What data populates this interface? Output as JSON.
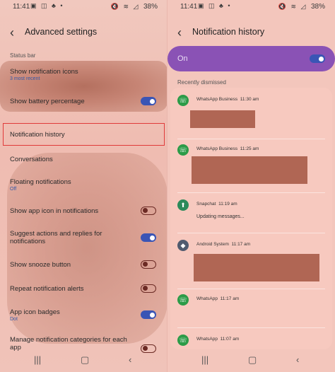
{
  "left": {
    "status": {
      "time": "11:41",
      "noti_icons": "▣ ◫ ♣ •",
      "sys_icons": "🔇 ≋ ◿",
      "battery": "38%"
    },
    "header": {
      "title": "Advanced settings"
    },
    "section_status_bar": "Status bar",
    "items": [
      {
        "label": "Show notification icons",
        "sub": "3 most recent"
      },
      {
        "label": "Show battery percentage",
        "toggle": "on"
      },
      {
        "label": "Notification history"
      },
      {
        "label": "Conversations"
      },
      {
        "label": "Floating notifications",
        "sub": "Off"
      },
      {
        "label": "Show app icon in notifications",
        "toggle": "off"
      },
      {
        "label": "Suggest actions and replies for notifications",
        "toggle": "on"
      },
      {
        "label": "Show snooze button",
        "toggle": "off"
      },
      {
        "label": "Repeat notification alerts",
        "toggle": "off"
      },
      {
        "label": "App icon badges",
        "sub": "Dot",
        "toggle": "on"
      },
      {
        "label": "Manage notification categories for each app",
        "toggle": "off"
      }
    ]
  },
  "right": {
    "status": {
      "time": "11:41",
      "noti_icons": "▣ ◫ ♣ •",
      "sys_icons": "🔇 ≋ ◿",
      "battery": "38%"
    },
    "header": {
      "title": "Notification history"
    },
    "master": {
      "label": "On",
      "toggle": "on"
    },
    "dismissed_label": "Recently dismissed",
    "notifications": [
      {
        "app": "WhatsApp Business",
        "time": "11:30 am",
        "icon": "whatsapp"
      },
      {
        "app": "WhatsApp Business",
        "time": "11:25 am",
        "icon": "whatsapp"
      },
      {
        "app": "Snapchat",
        "time": "11:19 am",
        "icon": "snapchat",
        "message": "Updating messages..."
      },
      {
        "app": "Android System",
        "time": "11:17 am",
        "icon": "android"
      },
      {
        "app": "WhatsApp",
        "time": "11:17 am",
        "icon": "whatsapp"
      },
      {
        "app": "WhatsApp",
        "time": "11:07 am",
        "icon": "whatsapp"
      }
    ]
  },
  "nav": {
    "recents": "|||",
    "home": "▢",
    "back": "‹"
  },
  "colors": {
    "accent_purple": "#8a52b5",
    "toggle_on": "#3a55b5",
    "highlight": "#e03a3a",
    "whatsapp": "#2c9b48"
  }
}
